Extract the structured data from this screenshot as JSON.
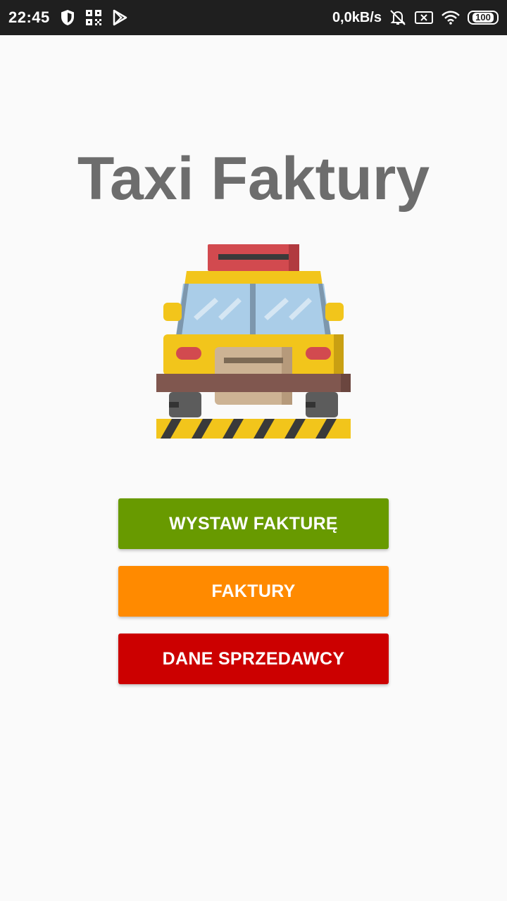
{
  "status_bar": {
    "time": "22:45",
    "network_speed": "0,0kB/s",
    "battery": "100",
    "icons": [
      "shield-icon",
      "qr-grid-icon",
      "play-store-icon",
      "bell-off-icon",
      "sim-off-icon",
      "wifi-icon",
      "battery-icon"
    ]
  },
  "app": {
    "title": "Taxi Faktury",
    "image": "taxi-car-icon"
  },
  "buttons": {
    "issue_invoice": "WYSTAW FAKTURĘ",
    "invoices": "FAKTURY",
    "seller_data": "DANE SPRZEDAWCY"
  },
  "colors": {
    "issue_invoice": "#689a00",
    "invoices": "#ff8a00",
    "seller_data": "#cc0000",
    "title": "#6d6d6d"
  }
}
